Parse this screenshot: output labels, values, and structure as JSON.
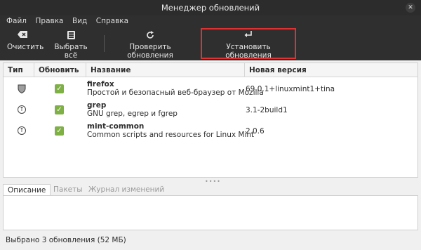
{
  "window": {
    "title": "Менеджер обновлений",
    "close_glyph": "✕"
  },
  "menu": [
    "Файл",
    "Правка",
    "Вид",
    "Справка"
  ],
  "toolbar": {
    "clear": {
      "label": "Очистить",
      "icon": "backspace-icon"
    },
    "select_all": {
      "label": "Выбрать всё",
      "icon": "select-all-icon"
    },
    "check": {
      "label": "Проверить обновления",
      "icon": "refresh-icon"
    },
    "install": {
      "label": "Установить обновления",
      "icon": "enter-icon"
    }
  },
  "table": {
    "columns": {
      "type": "Тип",
      "update": "Обновить",
      "name": "Название",
      "version": "Новая версия"
    },
    "rows": [
      {
        "pkg": "firefox",
        "desc": "Простой и безопасный веб-браузер от Mozilla",
        "version": "69.0.1+linuxmint1+tina",
        "type_icon": "shield-icon",
        "checked": true
      },
      {
        "pkg": "grep",
        "desc": "GNU grep, egrep и fgrep",
        "version": "3.1-2build1",
        "type_icon": "upgrade-arrow-icon",
        "checked": true
      },
      {
        "pkg": "mint-common",
        "desc": "Common scripts and resources for Linux Mint",
        "version": "2.0.6",
        "type_icon": "upgrade-arrow-icon",
        "checked": true
      }
    ]
  },
  "tabs": [
    "Описание",
    "Пакеты",
    "Журнал изменений"
  ],
  "status": "Выбрано 3 обновления (52 МБ)",
  "colors": {
    "checkbox": "#7fb045",
    "highlight": "#e03030",
    "toolbar_bg": "#2f2f2f"
  }
}
